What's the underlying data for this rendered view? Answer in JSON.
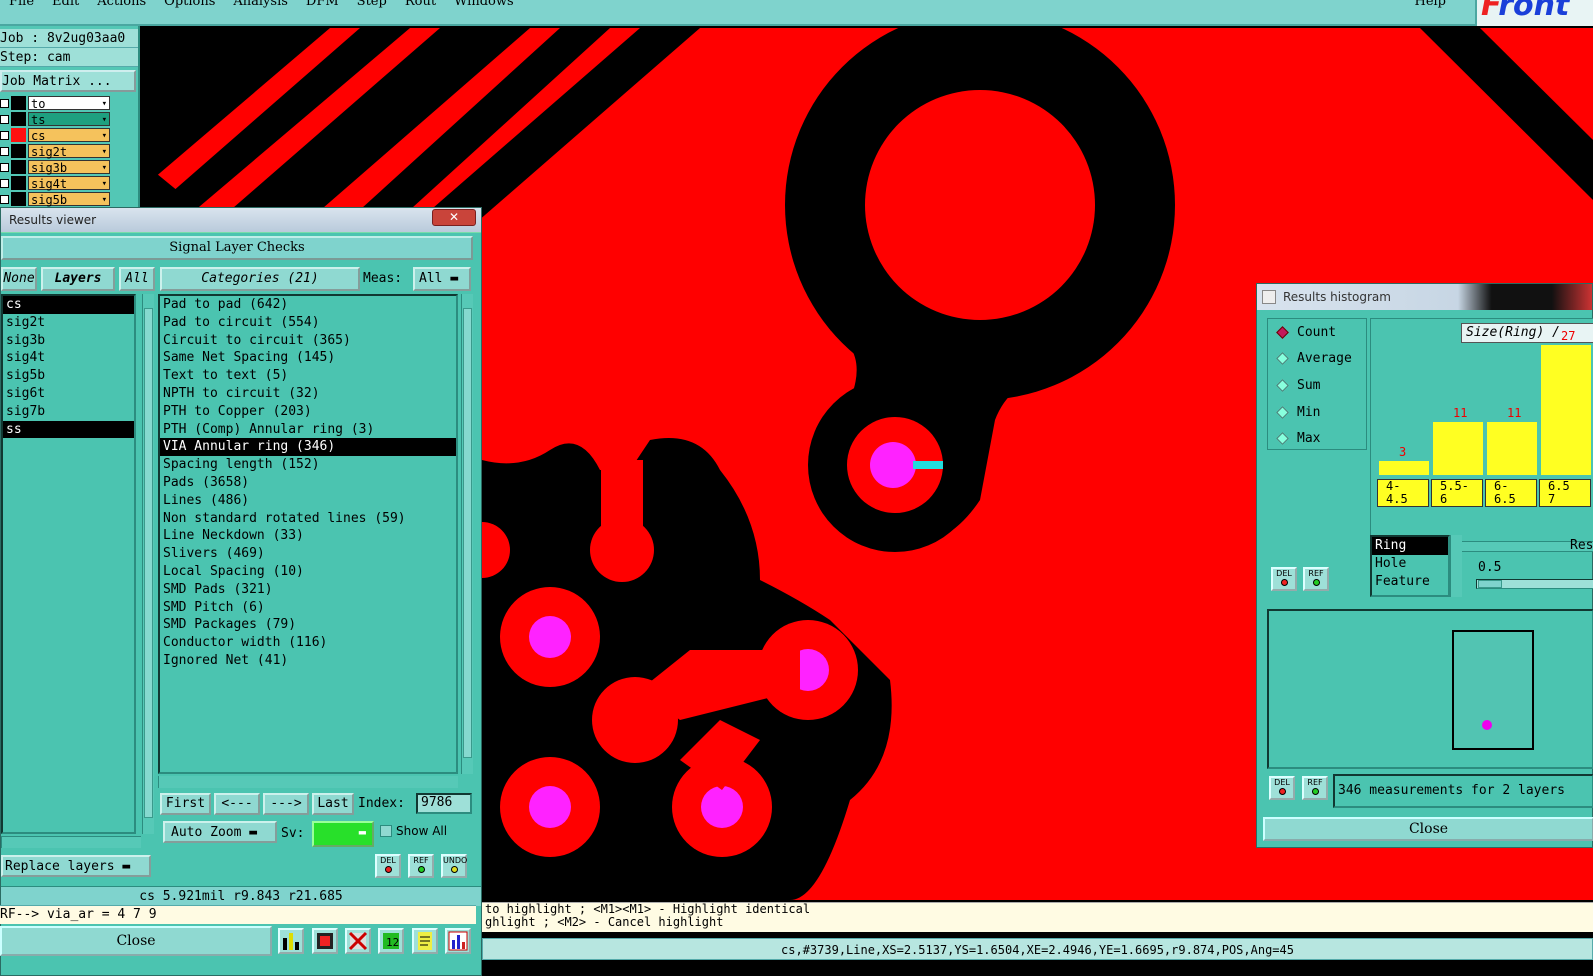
{
  "menubar": {
    "items": [
      "File",
      "Edit",
      "Actions",
      "Options",
      "Analysis",
      "DFM",
      "Step",
      "Rout",
      "Windows"
    ],
    "help": "Help",
    "logo": "Front"
  },
  "job_panel": {
    "job": "Job : 8v2ug03aa0",
    "step": "Step: cam",
    "job_matrix": "Job Matrix ...",
    "layers": [
      {
        "name": "to",
        "bg": "#ffffff",
        "swatch": "#000000"
      },
      {
        "name": "ts",
        "bg": "#1ea080",
        "swatch": "#000000"
      },
      {
        "name": "cs",
        "bg": "#f5c25c",
        "swatch": "#ff1010"
      },
      {
        "name": "sig2t",
        "bg": "#f5c25c",
        "swatch": "#000000"
      },
      {
        "name": "sig3b",
        "bg": "#f5c25c",
        "swatch": "#000000"
      },
      {
        "name": "sig4t",
        "bg": "#f5c25c",
        "swatch": "#000000"
      },
      {
        "name": "sig5b",
        "bg": "#f5c25c",
        "swatch": "#000000"
      }
    ]
  },
  "results_viewer": {
    "title": "Results viewer",
    "panel_title": "Signal Layer Checks",
    "btn_none": "None",
    "btn_layers": "Layers",
    "btn_all": "All",
    "btn_categories": "Categories (21)",
    "meas_label": "Meas:",
    "meas_value": "All",
    "layers": [
      "cs",
      "sig2t",
      "sig3b",
      "sig4t",
      "sig5b",
      "sig6t",
      "sig7b",
      "ss"
    ],
    "categories": [
      "Pad to pad (642)",
      "Pad to circuit (554)",
      "Circuit to circuit (365)",
      "Same Net Spacing (145)",
      "Text to text (5)",
      "NPTH to circuit (32)",
      "PTH to Copper (203)",
      "PTH (Comp) Annular ring (3)",
      "VIA Annular ring (346)",
      "Spacing length (152)",
      "Pads (3658)",
      "Lines (486)",
      "Non standard rotated lines (59)",
      "Line Neckdown (33)",
      "Slivers (469)",
      "Local Spacing (10)",
      "SMD Pads (321)",
      "SMD Pitch (6)",
      "SMD Packages (79)",
      "Conductor width (116)",
      "Ignored Net (41)"
    ],
    "nav": {
      "first": "First",
      "prev": "<---",
      "next": "--->",
      "last": "Last",
      "index_label": "Index:",
      "index_value": "9786"
    },
    "auto_zoom": "Auto Zoom",
    "sv_label": "Sv:",
    "show_all": "Show All",
    "replace_layers": "Replace layers",
    "status_line": "cs 5.921mil   r9.843   r21.685",
    "cmd_line": "RF--> via_ar = 4 7 9",
    "close": "Close",
    "icon_del": "DEL",
    "icon_ref": "REF",
    "icon_undo": "UNDO"
  },
  "histogram": {
    "title": "Results histogram",
    "modes": [
      "Count",
      "Average",
      "Sum",
      "Min",
      "Max"
    ],
    "selected_mode": "Count",
    "chart_title": "Size(Ring) /",
    "bars": [
      {
        "label": "4-\n4.5",
        "count": "3"
      },
      {
        "label": "5.5-\n6",
        "count": "11"
      },
      {
        "label": "6-\n6.5",
        "count": "11"
      },
      {
        "label": "6.5\n7",
        "count": "27"
      }
    ],
    "types": [
      "Ring",
      "Hole",
      "Feature"
    ],
    "res_label": "Res",
    "res_value": "0.5",
    "measurements": "346 measurements for 2 layers",
    "close": "Close",
    "icon_del": "DEL",
    "icon_ref": "REF"
  },
  "messages": {
    "line1": "to highlight ; <M1><M1> - Highlight identical",
    "line2": "ghlight ; <M2> - Cancel highlight"
  },
  "info_bar": "cs,#3739,Line,XS=2.5137,YS=1.6504,XE=2.4946,YE=1.6695,r9.874,POS,Ang=45",
  "colors": {
    "copper": "#ff0000",
    "pad": "#ff22ff",
    "marker": "#22dddd",
    "panel": "#4bc4b0"
  }
}
